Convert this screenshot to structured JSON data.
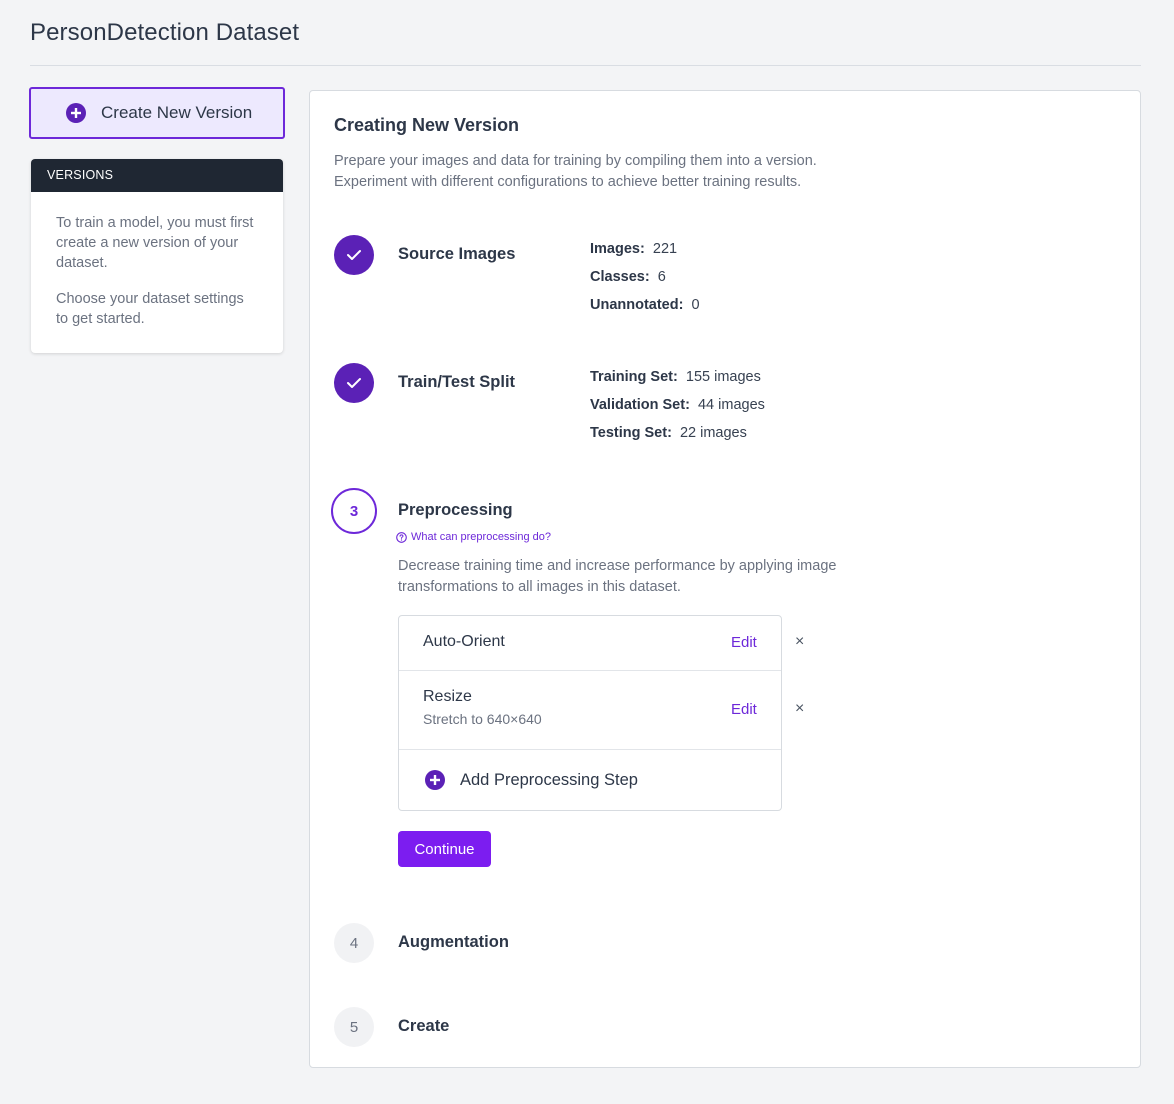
{
  "page": {
    "title": "PersonDetection Dataset"
  },
  "sidebar": {
    "create_button": "Create New Version",
    "versions_heading": "VERSIONS",
    "text1": "To train a model, you must first create a new version of your dataset.",
    "text2": "Choose your dataset settings to get started."
  },
  "main": {
    "heading": "Creating New Version",
    "desc_line1": "Prepare your images and data for training by compiling them into a version.",
    "desc_line2": "Experiment with different configurations to achieve better training results.",
    "steps": {
      "source": {
        "title": "Source Images",
        "stats": [
          {
            "label": "Images:",
            "value": "221"
          },
          {
            "label": "Classes:",
            "value": "6"
          },
          {
            "label": "Unannotated:",
            "value": "0"
          }
        ]
      },
      "split": {
        "title": "Train/Test Split",
        "stats": [
          {
            "label": "Training Set:",
            "value": "155 images"
          },
          {
            "label": "Validation Set:",
            "value": "44 images"
          },
          {
            "label": "Testing Set:",
            "value": "22 images"
          }
        ]
      },
      "preprocessing": {
        "number": "3",
        "title": "Preprocessing",
        "help_link": "What can preprocessing do?",
        "desc_line1": "Decrease training time and increase performance by applying image",
        "desc_line2": "transformations to all images in this dataset.",
        "items": [
          {
            "name": "Auto-Orient",
            "sub": "",
            "edit": "Edit",
            "remove": "×"
          },
          {
            "name": "Resize",
            "sub": "Stretch to 640×640",
            "edit": "Edit",
            "remove": "×"
          }
        ],
        "add_step": "Add Preprocessing Step",
        "continue": "Continue"
      },
      "augmentation": {
        "number": "4",
        "title": "Augmentation"
      },
      "create": {
        "number": "5",
        "title": "Create"
      }
    }
  },
  "colors": {
    "accent": "#6d28d9",
    "button": "#7c1df0",
    "dark_header": "#1f2733"
  }
}
